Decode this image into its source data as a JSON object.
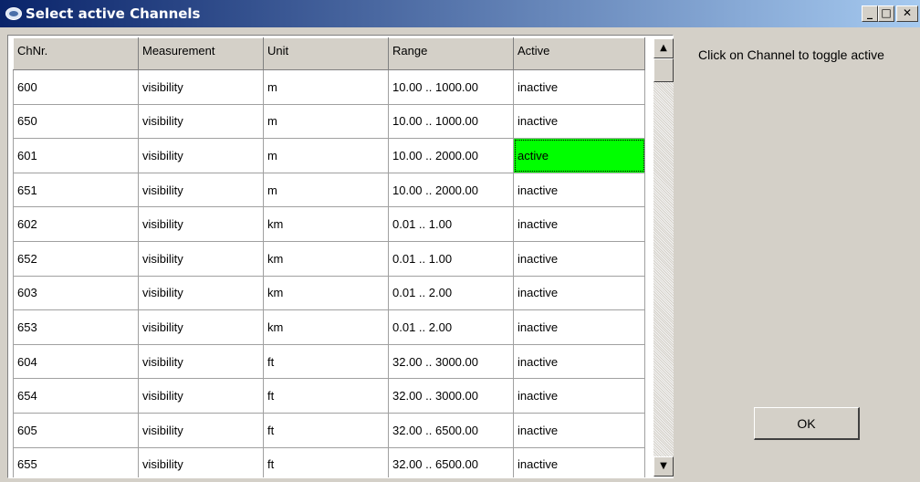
{
  "window": {
    "title": "Select active Channels",
    "app_icon": "app-globe-icon",
    "controls": {
      "minimize": "_",
      "maximize": "□",
      "close": "✕"
    }
  },
  "table": {
    "columns": [
      "ChNr.",
      "Measurement",
      "Unit",
      "Range",
      "Active"
    ],
    "rows": [
      [
        "600",
        "visibility",
        "m",
        "10.00 .. 1000.00",
        "inactive"
      ],
      [
        "650",
        "visibility",
        "m",
        "10.00 .. 1000.00",
        "inactive"
      ],
      [
        "601",
        "visibility",
        "m",
        "10.00 .. 2000.00",
        "active"
      ],
      [
        "651",
        "visibility",
        "m",
        "10.00 .. 2000.00",
        "inactive"
      ],
      [
        "602",
        "visibility",
        "km",
        "0.01 .. 1.00",
        "inactive"
      ],
      [
        "652",
        "visibility",
        "km",
        "0.01 .. 1.00",
        "inactive"
      ],
      [
        "603",
        "visibility",
        "km",
        "0.01 .. 2.00",
        "inactive"
      ],
      [
        "653",
        "visibility",
        "km",
        "0.01 .. 2.00",
        "inactive"
      ],
      [
        "604",
        "visibility",
        "ft",
        "32.00 .. 3000.00",
        "inactive"
      ],
      [
        "654",
        "visibility",
        "ft",
        "32.00 .. 3000.00",
        "inactive"
      ],
      [
        "605",
        "visibility",
        "ft",
        "32.00 .. 6500.00",
        "inactive"
      ],
      [
        "655",
        "visibility",
        "ft",
        "32.00 .. 6500.00",
        "inactive"
      ]
    ],
    "active_color": "#00ff00"
  },
  "scrollbar": {
    "up": "▲",
    "down": "▼"
  },
  "hint_text": "Click on Channel to toggle active",
  "ok_label": "OK",
  "colors": {
    "titlebar_start": "#0a246a",
    "titlebar_end": "#a6caf0",
    "dialog_bg": "#d4d0c8"
  }
}
